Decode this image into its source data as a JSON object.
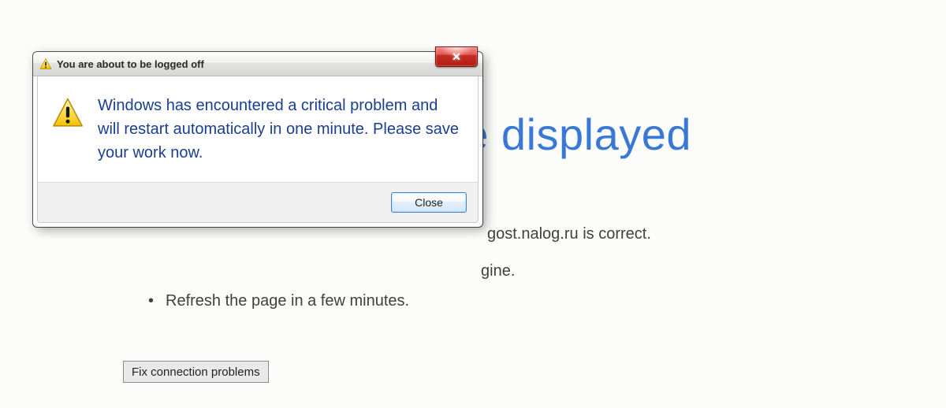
{
  "page": {
    "title": "This page can't be displayed",
    "bullets": {
      "b1_partial": "gost.nalog.ru is correct.",
      "b2_partial": "gine.",
      "b3": "Refresh the page in a few minutes."
    },
    "fix_button": "Fix connection problems"
  },
  "dialog": {
    "title": "You are about to be logged off",
    "message": "Windows has encountered a critical problem and will restart automatically in one minute. Please save your work now.",
    "close_x": "✕",
    "close_button": "Close"
  },
  "colors": {
    "link_blue": "#3a78d6",
    "dialog_text": "#1a3e90"
  }
}
